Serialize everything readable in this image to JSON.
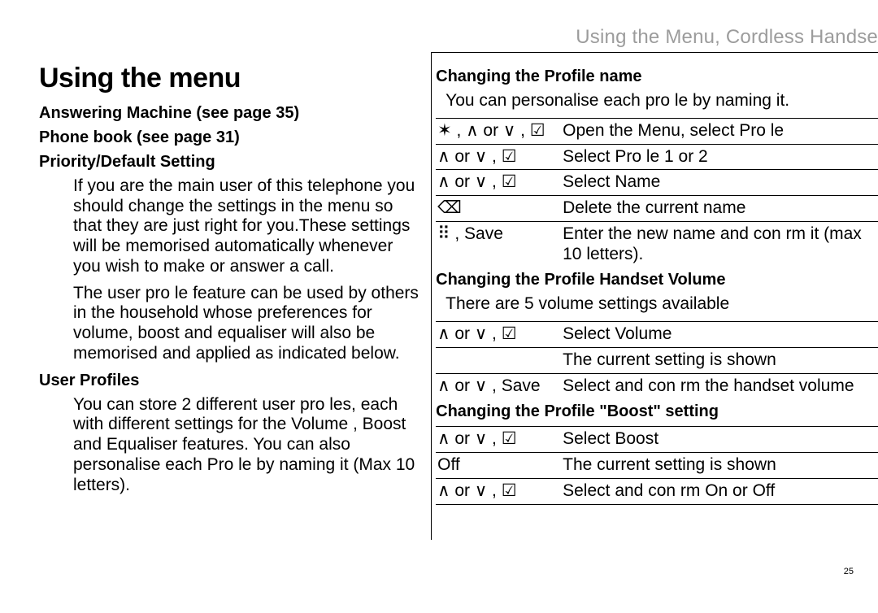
{
  "page_number": "25",
  "running_head": "Using the Menu, Cordless Handse",
  "left": {
    "title": "Using the menu",
    "sec1": "Answering Machine (see page 35)",
    "sec2": "Phone book (see page 31)",
    "sec3": "Priority/Default Setting",
    "p1": "If you are the main user of this telephone you should change the settings in the menu so that they are just right for you.These settings will be memorised automatically whenever you wish to make or answer a call.",
    "p2": "The user pro le feature can be used by others in the household whose preferences for volume, boost and equaliser will also be memorised and applied as indicated below.",
    "sec4": "User Profiles",
    "p3": "You can store 2 different user pro les, each with different settings for the  Volume ,  Boost  and  Equaliser  features. You can also personalise each Pro le by naming it (Max 10 letters)."
  },
  "right": {
    "secA": "Changing the Profile name",
    "pA": "You can personalise each pro le by naming it.",
    "tableA": [
      {
        "k": "✶ , ∧ or ∨ , ☑",
        "v": "Open the Menu, select  Pro le"
      },
      {
        "k": "∧ or ∨ , ☑",
        "v": "Select  Pro le 1 or 2"
      },
      {
        "k": "∧ or ∨ , ☑",
        "v": "Select  Name"
      },
      {
        "k": "⌫",
        "v": "Delete the current name"
      },
      {
        "k": "⠿ , Save",
        "v": "Enter the new name and con rm it (max 10 letters)."
      }
    ],
    "secB": "Changing the Profile Handset Volume",
    "pB": "There are 5 volume settings available",
    "tableB": [
      {
        "k": "∧ or ∨ , ☑",
        "v": "Select  Volume"
      },
      {
        "k": "",
        "v": "The current setting is shown"
      },
      {
        "k": "∧ or ∨ , Save",
        "v": "Select and con rm the handset volume"
      }
    ],
    "secC": "Changing the Profile \"Boost\" setting",
    "tableC": [
      {
        "k": "∧ or ∨ , ☑",
        "v": "Select  Boost"
      },
      {
        "k": "Off",
        "v": "The current setting is shown"
      },
      {
        "k": "∧ or ∨ , ☑",
        "v": "Select and con rm  On  or  Off"
      }
    ]
  }
}
